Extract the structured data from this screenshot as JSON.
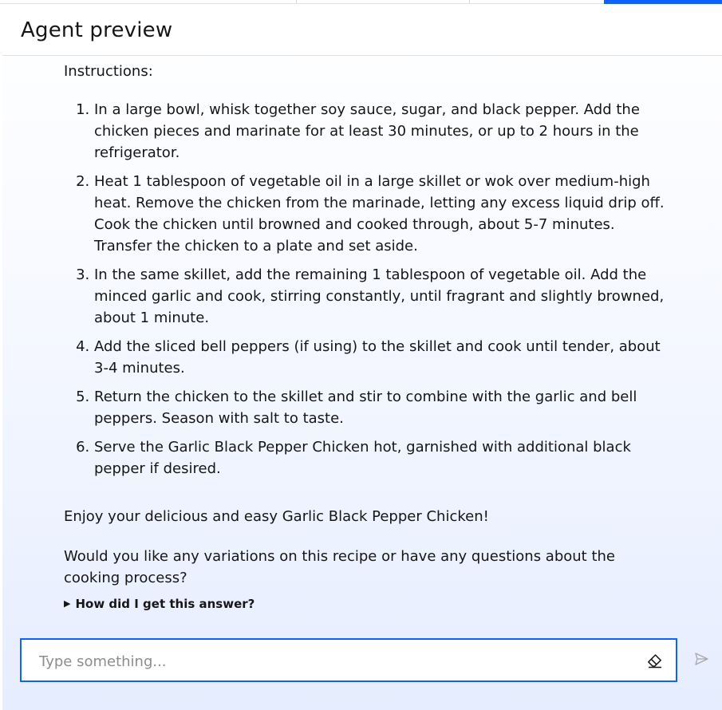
{
  "header": {
    "title": "Agent preview"
  },
  "message": {
    "intro": "Instructions:",
    "steps": [
      "In a large bowl, whisk together soy sauce, sugar, and black pepper. Add the chicken pieces and marinate for at least 30 minutes, or up to 2 hours in the refrigerator.",
      "Heat 1 tablespoon of vegetable oil in a large skillet or wok over medium-high heat. Remove the chicken from the marinade, letting any excess liquid drip off. Cook the chicken until browned and cooked through, about 5-7 minutes. Transfer the chicken to a plate and set aside.",
      "In the same skillet, add the remaining 1 tablespoon of vegetable oil. Add the minced garlic and cook, stirring constantly, until fragrant and slightly browned, about 1 minute.",
      "Add the sliced bell peppers (if using) to the skillet and cook until tender, about 3-4 minutes.",
      "Return the chicken to the skillet and stir to combine with the garlic and bell peppers. Season with salt to taste.",
      "Serve the Garlic Black Pepper Chicken hot, garnished with additional black pepper if desired."
    ],
    "closing": "Enjoy your delicious and easy Garlic Black Pepper Chicken!",
    "question": "Would you like any variations on this recipe or have any questions about the cooking process?",
    "explain_link": "How did I get this answer?"
  },
  "composer": {
    "placeholder": "Type something...",
    "clear_icon": "eraser-icon",
    "send_icon": "send-icon"
  },
  "colors": {
    "accent": "#0f62fe",
    "text": "#161616",
    "placeholder": "#8d8d8d",
    "send_disabled": "#a8a8a8"
  }
}
